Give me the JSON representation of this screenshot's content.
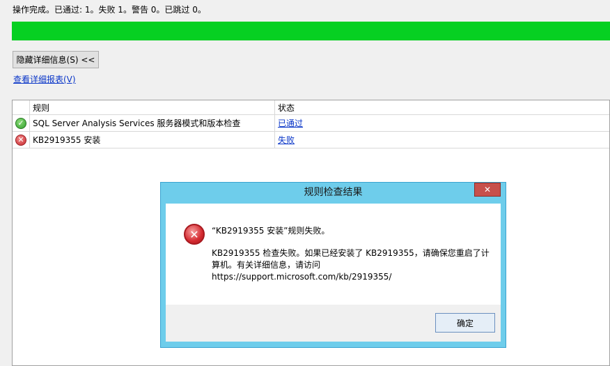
{
  "status": {
    "summary": "操作完成。已通过: 1。失败 1。警告 0。已跳过 0。",
    "progress_percent": 100,
    "progress_color": "#06d022"
  },
  "actions": {
    "hide_details_label": "隐藏详细信息(S) <<",
    "view_report_label": "查看详细报表(V)"
  },
  "table": {
    "columns": [
      "规则",
      "状态"
    ],
    "rows": [
      {
        "icon": "success-check-icon",
        "rule": "SQL Server Analysis Services 服务器模式和版本检查",
        "status": "已通过"
      },
      {
        "icon": "error-x-icon",
        "rule": "KB2919355 安装",
        "status": "失败"
      }
    ]
  },
  "dialog": {
    "title": "规则检查结果",
    "icon": "error-icon",
    "heading": "“KB2919355 安装”规则失败。",
    "message": "KB2919355 检查失败。如果已经安装了 KB2919355，请确保您重启了计算机。有关详细信息，请访问 https://support.microsoft.com/kb/2919355/",
    "ok_label": "确定"
  }
}
